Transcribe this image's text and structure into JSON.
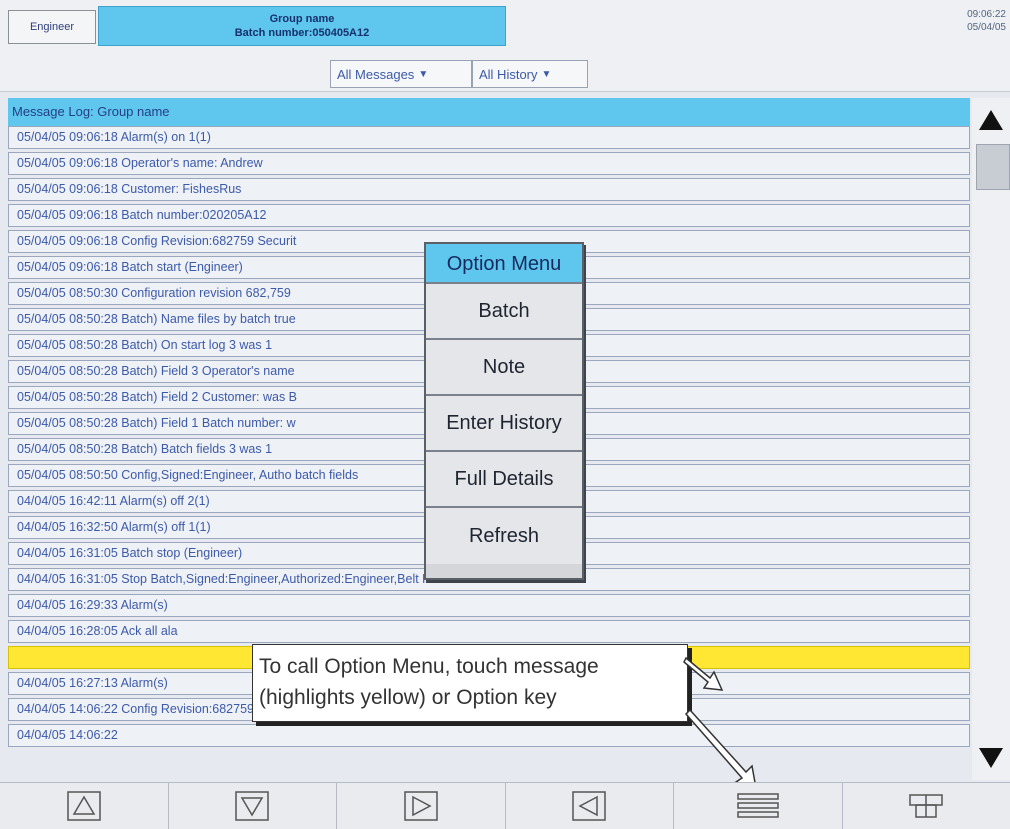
{
  "header": {
    "user_button": "Engineer",
    "group_name": "Group name",
    "batch_number": "Batch number:050405A12",
    "time": "09:06:22",
    "date": "05/04/05"
  },
  "filters": {
    "messages": "All Messages",
    "history": "All History"
  },
  "log": {
    "title": "Message Log: Group name",
    "rows": [
      "05/04/05 09:06:18 Alarm(s) on 1(1)",
      "05/04/05 09:06:18 Operator's name: Andrew",
      "05/04/05 09:06:18 Customer: FishesRus",
      "05/04/05 09:06:18 Batch number:020205A12",
      "05/04/05 09:06:18 Config Revision:682759 Securit",
      "05/04/05 09:06:18 Batch start (Engineer)",
      "05/04/05 08:50:30 Configuration revision 682,759",
      "05/04/05 08:50:28 Batch) Name files by batch true",
      "05/04/05 08:50:28 Batch) On start log 3 was 1",
      "05/04/05 08:50:28 Batch) Field 3 Operator's name",
      "05/04/05 08:50:28 Batch) Field 2 Customer: was B",
      "05/04/05 08:50:28 Batch) Field 1 Batch number: w",
      "05/04/05 08:50:28 Batch) Batch fields 3 was 1",
      "05/04/05 08:50:50 Config,Signed:Engineer, Autho                                  batch fields",
      "04/04/05 16:42:11 Alarm(s) off 2(1)",
      "04/04/05 16:32:50 Alarm(s) off 1(1)",
      "04/04/05 16:31:05 Batch stop (Engineer)",
      "04/04/05 16:31:05 Stop Batch,Signed:Engineer,Authorized:Engineer,Belt Failure",
      "04/04/05 16:29:33 Alarm(s)",
      "04/04/05 16:28:05 Ack all ala",
      "",
      "04/04/05 16:27:13 Alarm(s)",
      "04/04/05 14:06:22 Config Revision:682759 Security Revision 746261",
      "04/04/05 14:06:22"
    ]
  },
  "option_menu": {
    "title": "Option Menu",
    "items": [
      "Batch",
      "Note",
      "Enter History",
      "Full Details",
      "Refresh"
    ]
  },
  "callout": {
    "line1": "To call Option Menu, touch message",
    "line2": "(highlights yellow) or Option key"
  },
  "icons": {
    "bottom": [
      "up-triangle-icon",
      "down-triangle-icon",
      "right-triangle-icon",
      "left-triangle-icon",
      "option-menu-icon",
      "grid-icon"
    ]
  },
  "colors": {
    "header_accent": "#5fc6ee",
    "selected_row": "#ffe733",
    "text": "#3d5aa8"
  }
}
